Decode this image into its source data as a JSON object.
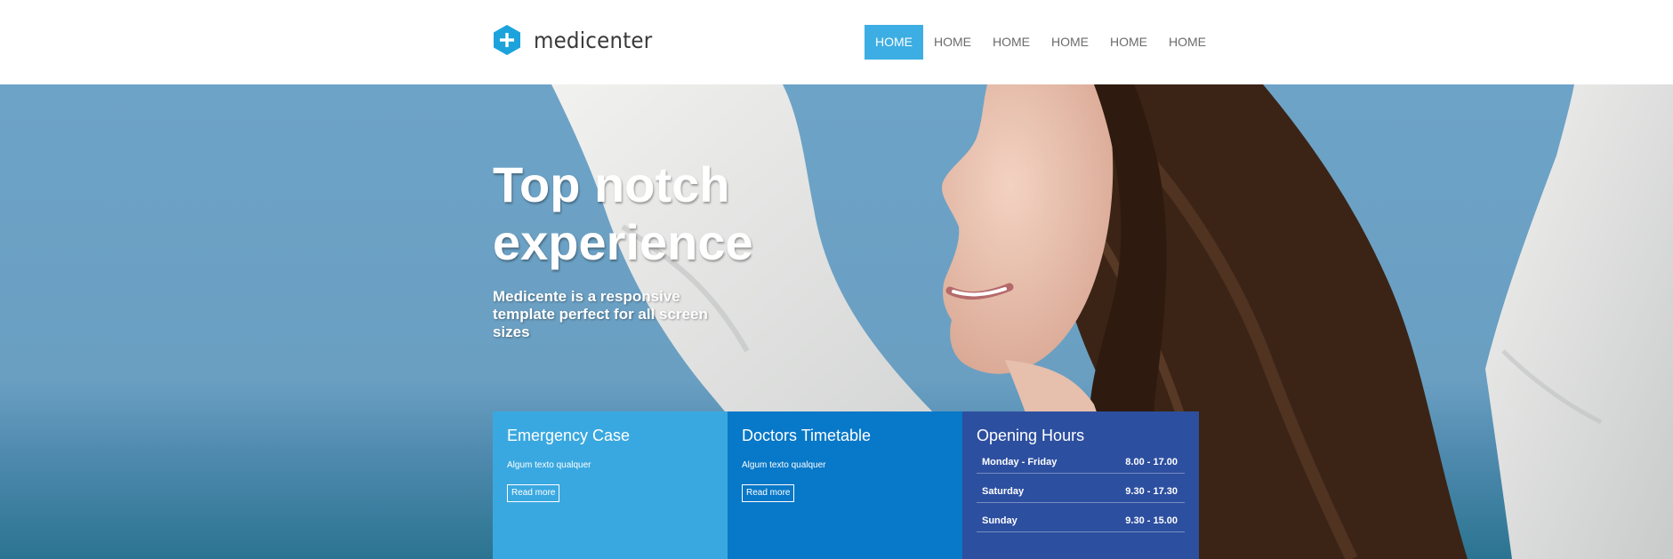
{
  "header": {
    "logo_text": "medicenter",
    "nav": [
      "HOME",
      "HOME",
      "HOME",
      "HOME",
      "HOME",
      "HOME"
    ],
    "active_index": 0
  },
  "hero": {
    "title_line1": "Top notch",
    "title_line2": "experience",
    "subtitle": "Medicente is a responsive template perfect for all screen sizes"
  },
  "boxes": [
    {
      "title": "Emergency Case",
      "text": "Algum texto qualquer",
      "button": "Read more"
    },
    {
      "title": "Doctors Timetable",
      "text": "Algum texto qualquer",
      "button": "Read more"
    },
    {
      "title": "Opening Hours",
      "hours": [
        {
          "day": "Monday - Friday",
          "time": "8.00 - 17.00"
        },
        {
          "day": "Saturday",
          "time": "9.30 - 17.30"
        },
        {
          "day": "Sunday",
          "time": "9.30 - 15.00"
        }
      ]
    }
  ],
  "colors": {
    "accent": "#3daee3",
    "box1": "#3aa8e0",
    "box2": "#0878c8",
    "box3": "#2d4fa0"
  },
  "icons": {
    "logo": "plus-hexagon-icon"
  }
}
